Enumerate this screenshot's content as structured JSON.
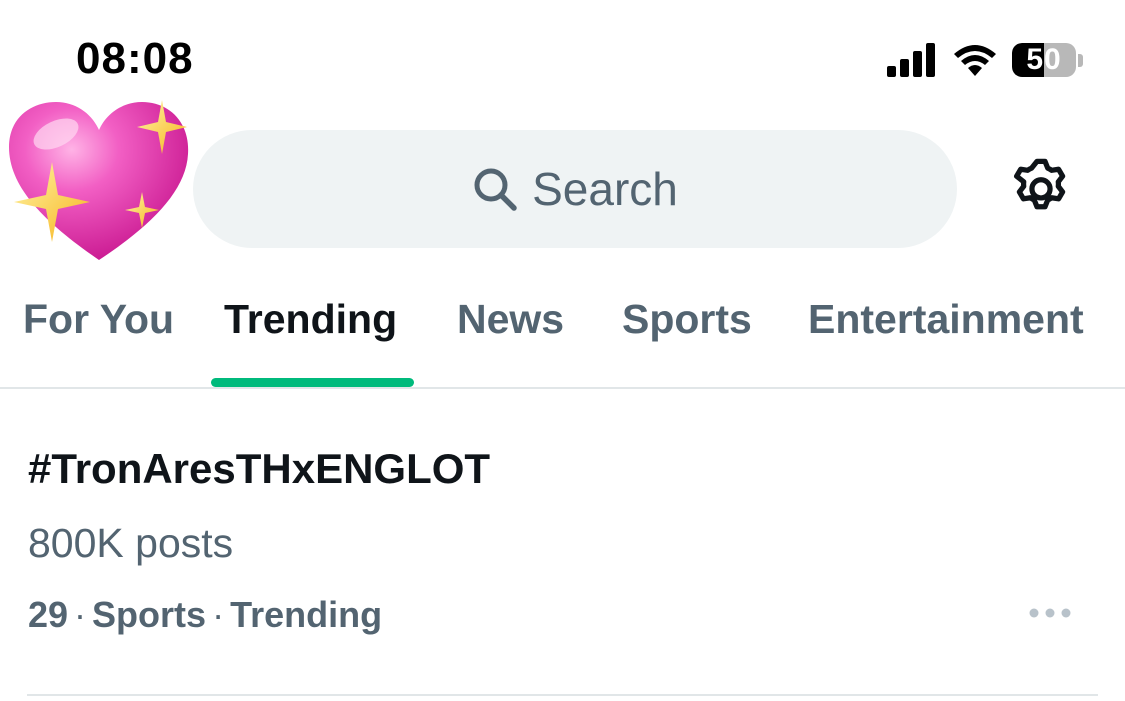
{
  "status_bar": {
    "time": "08:08",
    "battery_level": "50",
    "battery_fraction": 0.5
  },
  "header": {
    "avatar_icon": "sparkling-heart-emoji",
    "search": {
      "placeholder": "Search",
      "icon": "search-icon"
    },
    "settings_icon": "gear-icon"
  },
  "tabs": [
    {
      "label": "For You",
      "active": false
    },
    {
      "label": "Trending",
      "active": true
    },
    {
      "label": "News",
      "active": false
    },
    {
      "label": "Sports",
      "active": false
    },
    {
      "label": "Entertainment",
      "active": false
    }
  ],
  "trends": [
    {
      "title": "#TronAresTHxENGLOT",
      "posts": "800K posts",
      "rank": "29",
      "category": "Sports",
      "status": "Trending",
      "more_icon": "more-horizontal-icon"
    }
  ],
  "colors": {
    "accent": "#00ba7c",
    "secondary_text": "#536471",
    "primary_text": "#0f1419",
    "search_background": "#eff3f4"
  }
}
